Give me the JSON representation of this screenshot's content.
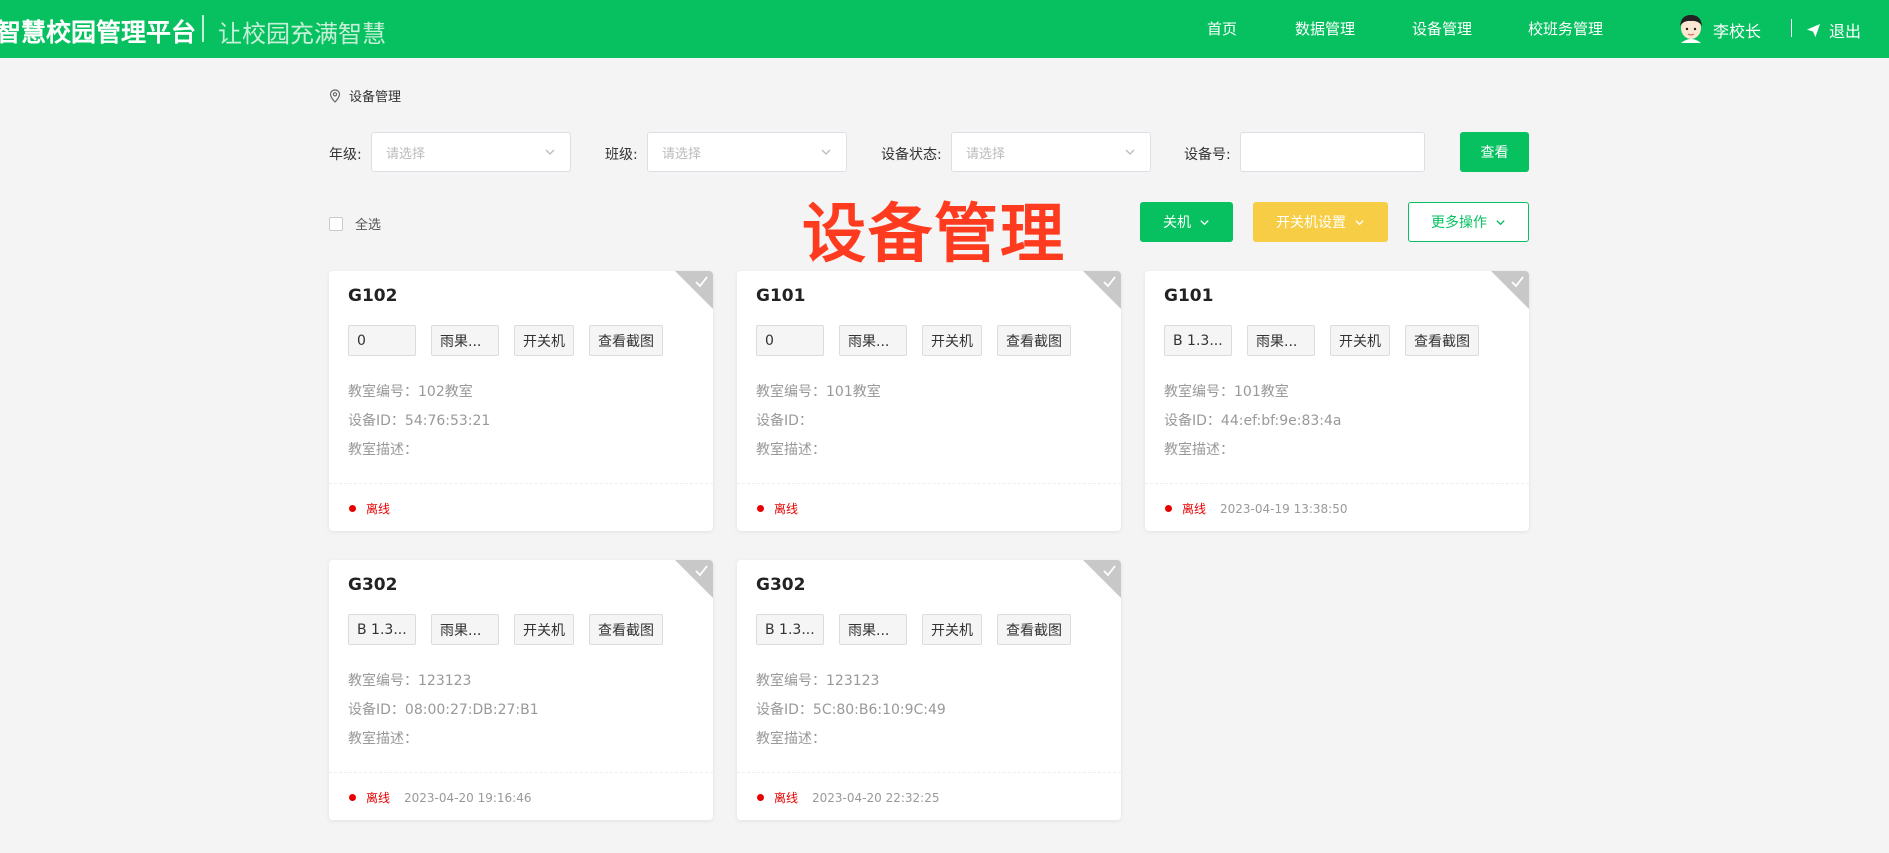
{
  "header": {
    "brand": "智慧校园管理平台",
    "slogan": "让校园充满智慧",
    "nav": [
      "首页",
      "数据管理",
      "设备管理",
      "校班务管理"
    ],
    "user": "李校长",
    "logout": "退出"
  },
  "breadcrumb": "设备管理",
  "filters": {
    "grade_label": "年级:",
    "class_label": "班级:",
    "status_label": "设备状态:",
    "device_no_label": "设备号:",
    "placeholder": "请选择",
    "device_no_value": "",
    "view_button": "查看"
  },
  "toolbar": {
    "select_all": "全选",
    "title": "设备管理",
    "power_off": "关机",
    "schedule": "开关机设置",
    "more": "更多操作"
  },
  "labels": {
    "room_no": "教室编号：",
    "device_id": "设备ID：",
    "room_desc": "教室描述：",
    "power_btn": "开关机",
    "screenshot_btn": "查看截图"
  },
  "cards": [
    {
      "title": "G102",
      "value": "0",
      "brand": "雨果...",
      "room_no": "102教室",
      "device_id": "54:76:53:21",
      "desc": "",
      "status": "离线",
      "time": ""
    },
    {
      "title": "G101",
      "value": "0",
      "brand": "雨果...",
      "room_no": "101教室",
      "device_id": "",
      "desc": "",
      "status": "离线",
      "time": ""
    },
    {
      "title": "G101",
      "value": "B 1.3...",
      "brand": "雨果...",
      "room_no": "101教室",
      "device_id": "44:ef:bf:9e:83:4a",
      "desc": "",
      "status": "离线",
      "time": "2023-04-19 13:38:50"
    },
    {
      "title": "G302",
      "value": "B 1.3...",
      "brand": "雨果...",
      "room_no": "123123",
      "device_id": "08:00:27:DB:27:B1",
      "desc": "",
      "status": "离线",
      "time": "2023-04-20 19:16:46"
    },
    {
      "title": "G302",
      "value": "B 1.3...",
      "brand": "雨果...",
      "room_no": "123123",
      "device_id": "5C:80:B6:10:9C:49",
      "desc": "",
      "status": "离线",
      "time": "2023-04-20 22:32:25"
    }
  ],
  "colors": {
    "primary": "#07c160",
    "warning": "#f7cd45",
    "title_red": "#ff3b1f",
    "offline": "#e60000"
  }
}
